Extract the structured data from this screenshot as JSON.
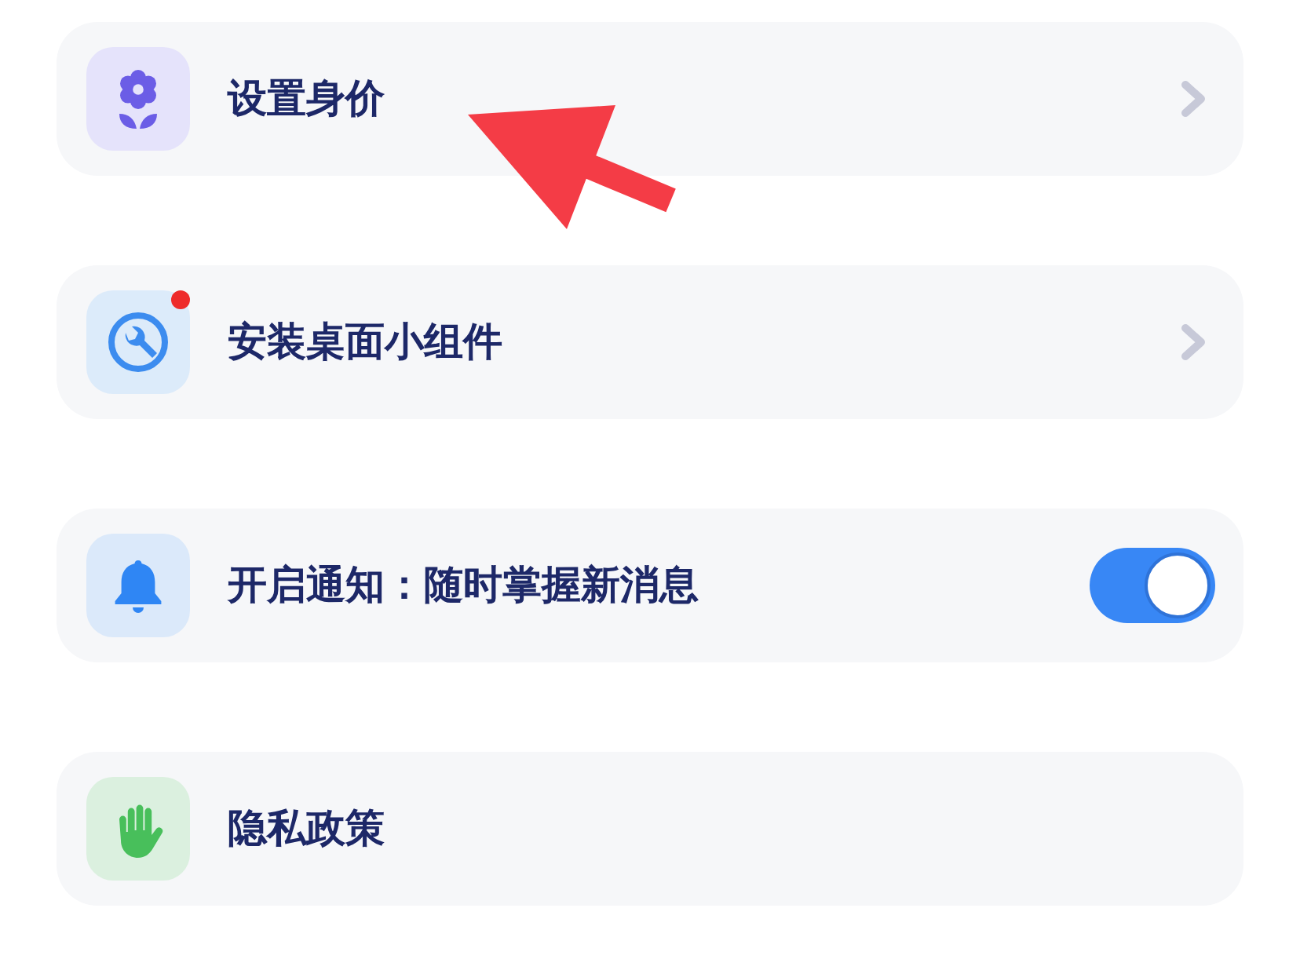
{
  "items": [
    {
      "kind": "link",
      "label": "设置身价",
      "badge": false
    },
    {
      "kind": "link",
      "label": "安装桌面小组件",
      "badge": true
    },
    {
      "kind": "toggle",
      "label": "开启通知：随时掌握新消息",
      "badge": false,
      "on": true
    },
    {
      "kind": "plain",
      "label": "隐私政策",
      "badge": false
    }
  ]
}
